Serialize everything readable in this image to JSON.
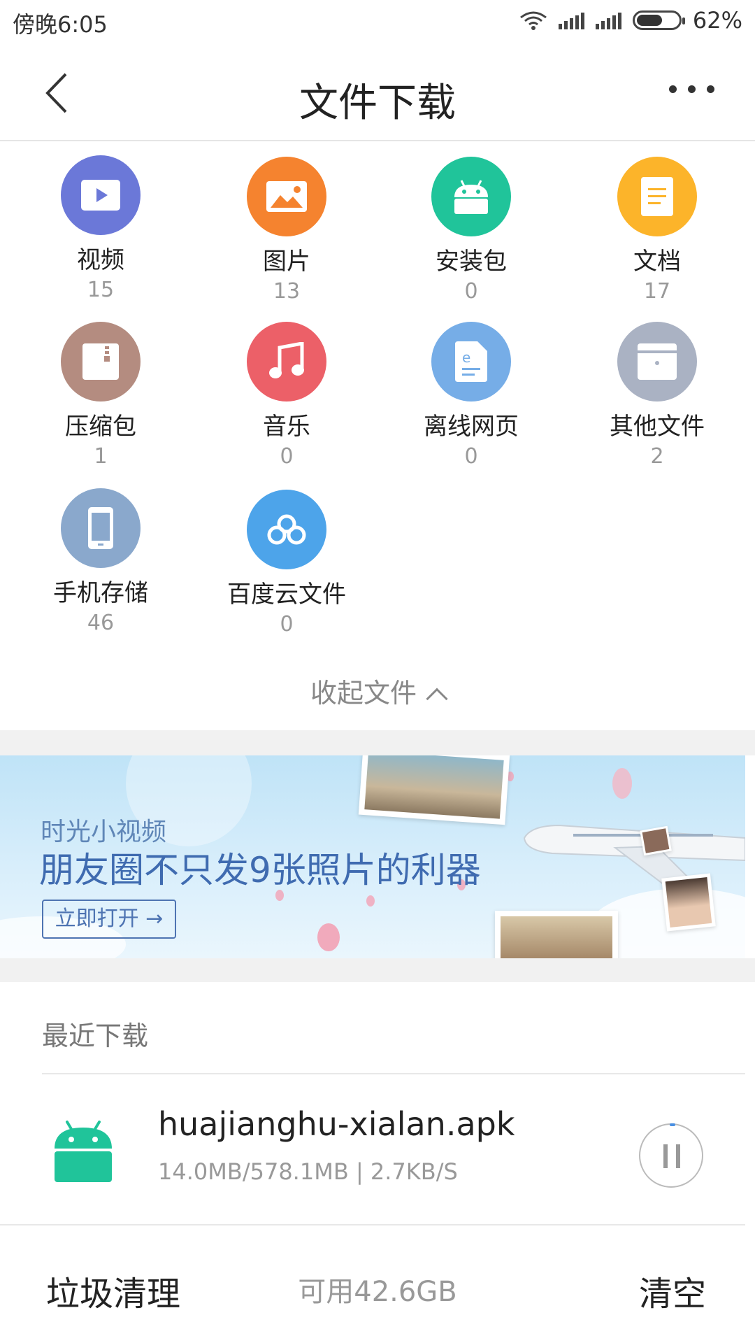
{
  "status_bar": {
    "time": "傍晚6:05",
    "battery_percent": "62%",
    "battery_level": 0.62
  },
  "header": {
    "title": "文件下载",
    "back_icon": "chevron-left-icon",
    "more_icon": "more-dots-icon"
  },
  "categories": [
    {
      "label": "视频",
      "count": "15",
      "color": "#6b78d8",
      "icon": "video-icon"
    },
    {
      "label": "图片",
      "count": "13",
      "color": "#f5832f",
      "icon": "image-icon"
    },
    {
      "label": "安装包",
      "count": "0",
      "color": "#20c49a",
      "icon": "android-icon"
    },
    {
      "label": "文档",
      "count": "17",
      "color": "#fcb42a",
      "icon": "document-icon"
    },
    {
      "label": "压缩包",
      "count": "1",
      "color": "#b48c80",
      "icon": "zip-icon"
    },
    {
      "label": "音乐",
      "count": "0",
      "color": "#ec6068",
      "icon": "music-icon"
    },
    {
      "label": "离线网页",
      "count": "0",
      "color": "#76ade7",
      "icon": "webpage-icon"
    },
    {
      "label": "其他文件",
      "count": "2",
      "color": "#aab2c3",
      "icon": "other-file-icon"
    },
    {
      "label": "手机存储",
      "count": "46",
      "color": "#8aa8cc",
      "icon": "phone-icon"
    },
    {
      "label": "百度云文件",
      "count": "0",
      "color": "#4da4ea",
      "icon": "cloud-icon"
    }
  ],
  "collapse_label": "收起文件",
  "banner": {
    "subtitle": "时光小视频",
    "headline": "朋友圈不只发9张照片的利器",
    "button_label": "立即打开 →"
  },
  "recent": {
    "title": "最近下载",
    "items": [
      {
        "name": "huajianghu-xialan.apk",
        "meta": "14.0MB/578.1MB | 2.7KB/S",
        "icon": "android-icon",
        "color": "#20c49a"
      }
    ]
  },
  "bottom_bar": {
    "left_label": "垃圾清理",
    "available": "可用42.6GB",
    "right_label": "清空"
  }
}
